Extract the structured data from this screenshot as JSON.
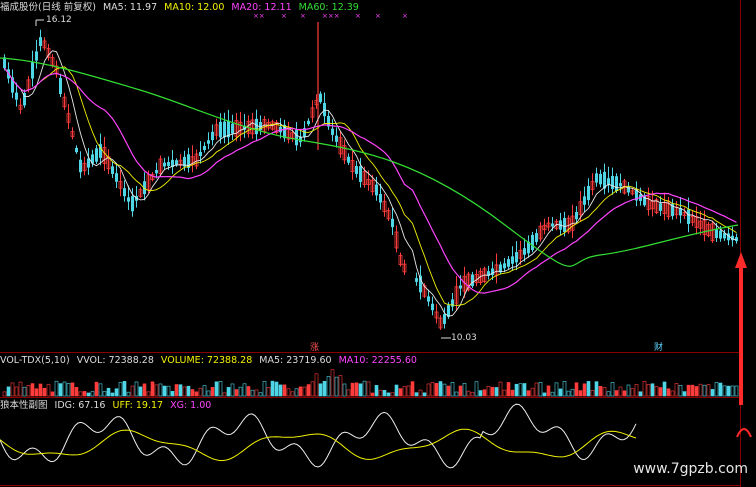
{
  "main_header": {
    "name": "福成股份(日线 前复权)",
    "ma5": "MA5: 11.97",
    "ma10": "MA10: 12.00",
    "ma20": "MA20: 12.11",
    "ma60": "MA60: 12.39"
  },
  "price_labels": {
    "high": "16.12",
    "low": "10.03"
  },
  "event_tags": {
    "tag1": "涨",
    "tag2": "财"
  },
  "vol_header": {
    "name": "VOL-TDX(5,10)",
    "vvol": "VVOL: 72388.28",
    "volume": "VOLUME: 72388.28",
    "ma5": "MA5: 23719.60",
    "ma10": "MA10: 22255.60"
  },
  "ind_header": {
    "name": "狼本性副图",
    "idg": "IDG: 67.16",
    "uff": "UFF: 19.17",
    "xg": "XG: 1.00"
  },
  "watermark": "www.7gpzb.com",
  "colors": {
    "up": "#ff3c3c",
    "down": "#4fd6e6",
    "ma5": "#e8e8e8",
    "ma10": "#f2f200",
    "ma20": "#ff44ff",
    "ma60": "#33dd33",
    "grid": "#7a0000"
  }
}
